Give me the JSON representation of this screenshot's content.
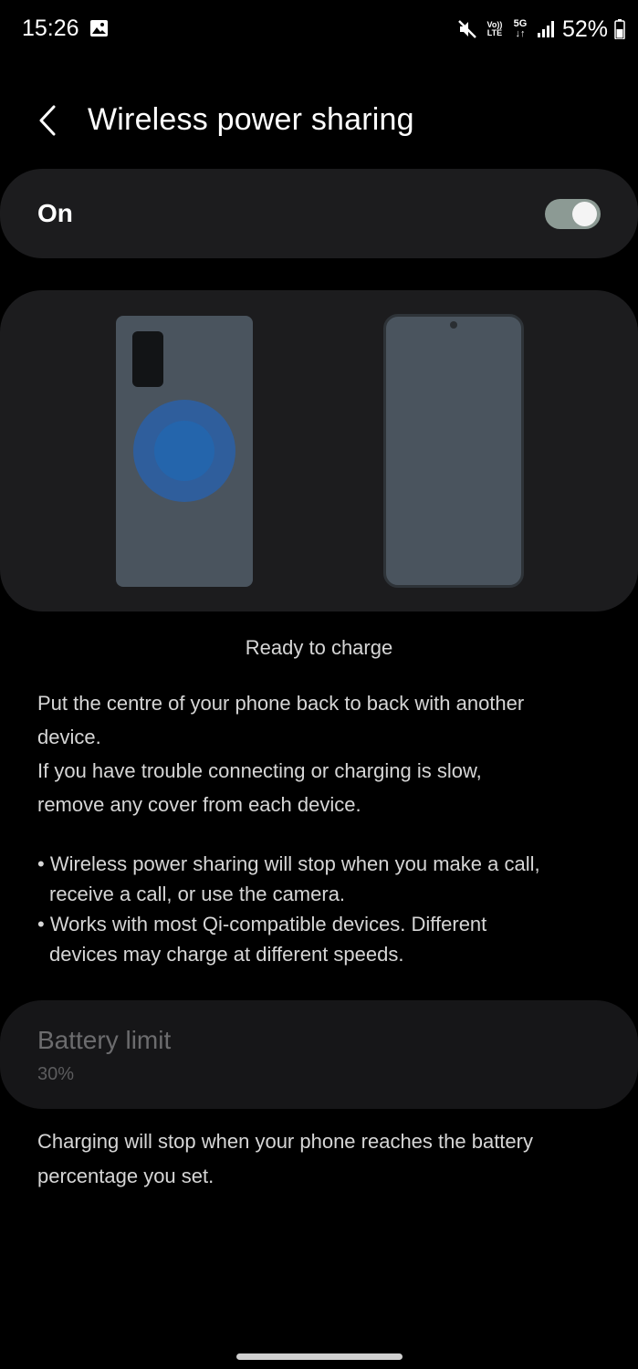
{
  "status_bar": {
    "time": "15:26",
    "volte_top": "Vo))",
    "volte_bottom": "LTE",
    "network_top": "5G",
    "network_bottom": "↓↑",
    "battery_percent": "52%",
    "icons": [
      "gallery-icon",
      "mute-icon",
      "signal-icon",
      "battery-icon"
    ]
  },
  "header": {
    "title": "Wireless power sharing",
    "back_icon": "chevron-left-icon"
  },
  "master_switch": {
    "label": "On",
    "enabled": true,
    "track_color": "#8c9a94"
  },
  "illustration": {
    "coil_color": "#2465ac",
    "phone_color": "#4a545e"
  },
  "status_caption": "Ready to charge",
  "instructions": {
    "lines": [
      "Put the centre of your phone back to back with another",
      "device.",
      "If you have trouble connecting or charging is slow,",
      "remove any cover from each device."
    ]
  },
  "bullets": {
    "lines": [
      "• Wireless power sharing will stop when you make a call,",
      "receive a call, or use the camera.",
      "• Works with most Qi-compatible devices. Different",
      "devices may charge at different speeds."
    ]
  },
  "battery_limit": {
    "title": "Battery limit",
    "value": "30%"
  },
  "limit_footnote": {
    "lines": [
      "Charging will stop when your phone reaches the battery",
      "percentage you set."
    ]
  }
}
